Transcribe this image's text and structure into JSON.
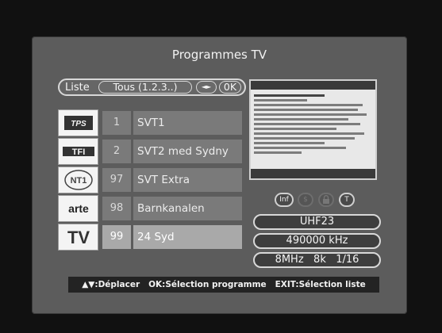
{
  "title": "Programmes TV",
  "filter": {
    "label": "Liste",
    "list_value": "Tous (1.2.3..)",
    "arrows": "◄►",
    "ok": "0K"
  },
  "channels": [
    {
      "logo": "TPS",
      "num": "1",
      "name": "SVT1"
    },
    {
      "logo": "TF1",
      "num": "2",
      "name": "SVT2 med Sydny"
    },
    {
      "logo": "NT1",
      "num": "97",
      "name": "SVT Extra"
    },
    {
      "logo": "arte",
      "num": "98",
      "name": "Barnkanalen"
    },
    {
      "logo": "TV",
      "num": "99",
      "name": "24 Syd"
    }
  ],
  "icons": [
    "Inf",
    "$",
    "lock",
    "T"
  ],
  "info": {
    "band": "UHF23",
    "frequency": "490000 kHz",
    "params": "8MHz   8k   1/16"
  },
  "help": "▲▼:Déplacer   OK:Sélection programme   EXIT:Sélection liste"
}
